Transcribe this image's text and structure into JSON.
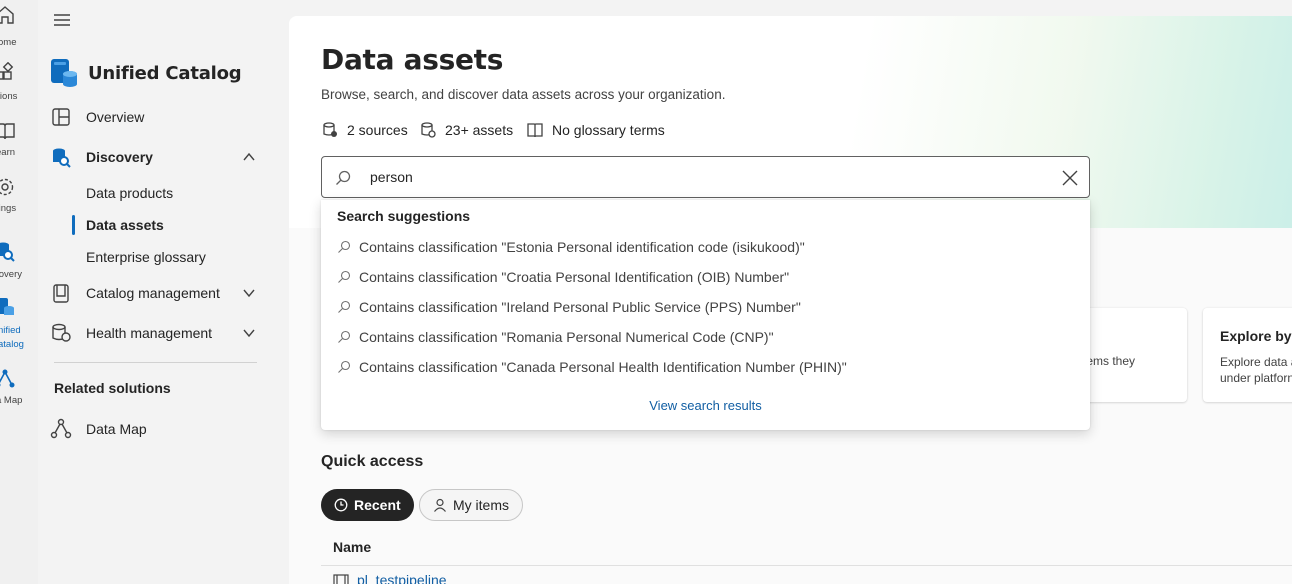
{
  "app_rail": {
    "items": [
      {
        "label": "Home",
        "icon": "home-icon"
      },
      {
        "label": "Solutions",
        "icon": "solutions-icon"
      },
      {
        "label": "Learn",
        "icon": "learn-icon"
      },
      {
        "label": "Settings",
        "icon": "settings-icon"
      },
      {
        "label": "Discovery",
        "icon": "discovery-icon"
      },
      {
        "label": "Unified Catalog",
        "icon": "unified-catalog-icon"
      },
      {
        "label": "Data Map",
        "icon": "data-map-icon"
      }
    ],
    "visible_labels": [
      "ome",
      "utions",
      "earn",
      "tings",
      "covery",
      "nified",
      "atalog",
      "a Map"
    ]
  },
  "nav": {
    "brand_title": "Unified Catalog",
    "overview": "Overview",
    "discovery": "Discovery",
    "discovery_items": [
      "Data products",
      "Data assets",
      "Enterprise glossary"
    ],
    "catalog_management": "Catalog management",
    "health_management": "Health management",
    "related_title": "Related solutions",
    "data_map": "Data Map"
  },
  "page": {
    "title": "Data assets",
    "subtitle": "Browse, search, and discover data assets across your organization.",
    "stats": {
      "sources": "2 sources",
      "assets": "23+ assets",
      "glossary": "No glossary terms"
    }
  },
  "search": {
    "value": "person",
    "suggestions_title": "Search suggestions",
    "suggestions": [
      "Contains classification \"Estonia Personal identification code (isikukood)\"",
      "Contains classification \"Croatia Personal Identification (OIB) Number\"",
      "Contains classification \"Ireland Personal Public Service (PPS) Number\"",
      "Contains classification \"Romania Personal Numerical Code (CNP)\"",
      "Contains classification \"Canada Personal Health Identification Number (PHIN)\""
    ],
    "view_results": "View search results"
  },
  "cards": {
    "card1_desc_visible": "ems they",
    "card2_title": "Explore by",
    "card2_desc_line1": "Explore data a",
    "card2_desc_line2": "under platforn"
  },
  "quick_access": {
    "title": "Quick access",
    "tab_recent": "Recent",
    "tab_my_items": "My items",
    "column_name": "Name",
    "first_row": "pl_testpipeline"
  },
  "colors": {
    "accent": "#0f6cbd",
    "link": "#115ea3",
    "text": "#242424",
    "nav_bg": "#f3f3f3",
    "pill_dark": "#242424"
  }
}
